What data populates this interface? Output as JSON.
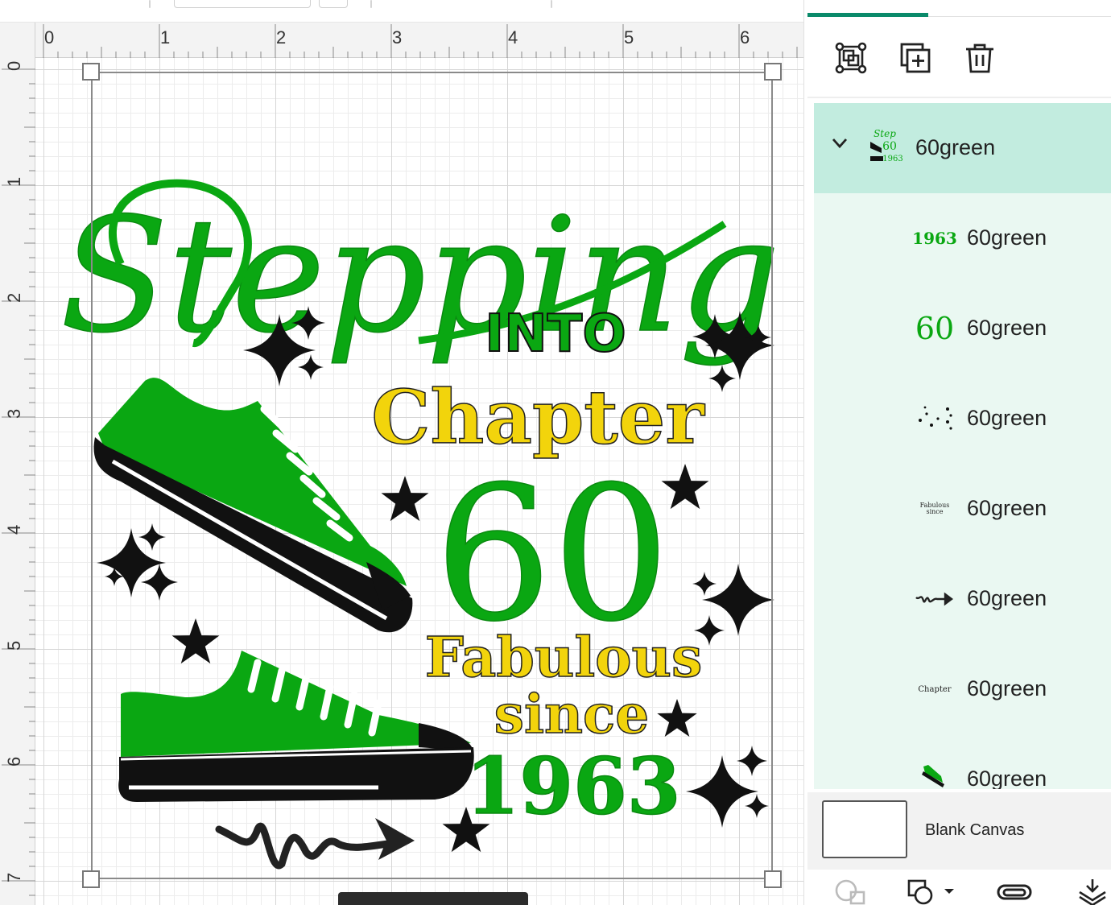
{
  "ruler": {
    "top": [
      "0",
      "1",
      "2",
      "3",
      "4",
      "5",
      "6"
    ],
    "left": [
      "0",
      "1",
      "2",
      "3",
      "4",
      "5",
      "6",
      "7"
    ]
  },
  "design": {
    "word_stepping": "Stepping",
    "word_into": "INTO",
    "word_chapter": "Chapter",
    "word_sixty": "60",
    "word_fabulous": "Fabulous",
    "word_since": "since",
    "word_year": "1963",
    "colors": {
      "green": "#0aa712",
      "yellow": "#f2d40c",
      "black": "#111111"
    }
  },
  "toolbar": {
    "icons": [
      "group-icon",
      "duplicate-icon",
      "delete-icon"
    ]
  },
  "layers": {
    "group": {
      "name": "60green",
      "expanded": true
    },
    "items": [
      {
        "name": "60green",
        "thumb_text": "1963",
        "thumb_icon": ""
      },
      {
        "name": "60green",
        "thumb_text": "60",
        "thumb_icon": ""
      },
      {
        "name": "60green",
        "thumb_text": "",
        "thumb_icon": "stars-thumb-icon"
      },
      {
        "name": "60green",
        "thumb_text": "Fabulous since",
        "thumb_icon": ""
      },
      {
        "name": "60green",
        "thumb_text": "",
        "thumb_icon": "arrow-thumb-icon"
      },
      {
        "name": "60green",
        "thumb_text": "Chapter",
        "thumb_icon": ""
      },
      {
        "name": "60green",
        "thumb_text": "",
        "thumb_icon": "shoe-thumb-icon"
      }
    ]
  },
  "blank_canvas": {
    "label": "Blank Canvas"
  },
  "bottom_icons": [
    "combine-icon",
    "shape-icon",
    "attach-icon",
    "flatten-icon"
  ]
}
